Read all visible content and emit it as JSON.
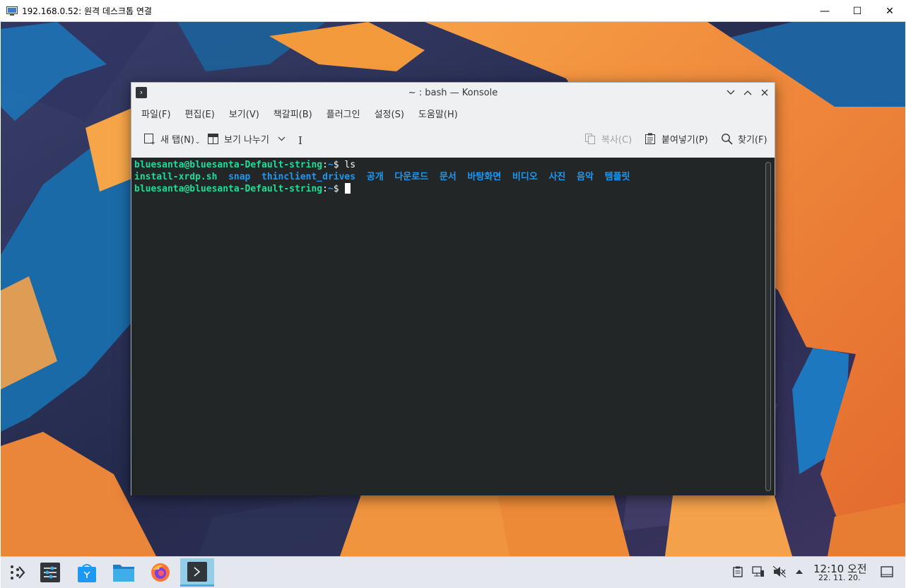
{
  "rdp": {
    "title": "192.168.0.52: 원격 데스크톱 연결",
    "minimize_glyph": "—",
    "maximize_glyph": "☐",
    "close_glyph": "✕"
  },
  "konsole": {
    "title": "~ : bash — Konsole",
    "menu": [
      "파일(F)",
      "편집(E)",
      "보기(V)",
      "책갈피(B)",
      "플러그인",
      "설정(S)",
      "도움말(H)"
    ],
    "toolbar": {
      "new_tab": "새 탭(N)",
      "split_view": "보기 나누기",
      "copy": "복사(C)",
      "paste": "붙여넣기(P)",
      "find": "찾기(F)"
    },
    "terminal": {
      "prompt_user": "bluesanta@bluesanta-Default-string",
      "prompt_path": "~",
      "prompt_symbol": "$",
      "command": " ls",
      "ls_files": [
        "install-xrdp.sh"
      ],
      "ls_dirs": [
        "snap",
        "thinclient_drives",
        "공개",
        "다운로드",
        "문서",
        "바탕화면",
        "비디오",
        "사진",
        "음악",
        "템플릿"
      ]
    }
  },
  "taskbar": {
    "apps": [
      "app-launcher-icon",
      "system-settings-icon",
      "discover-icon",
      "dolphin-icon",
      "firefox-icon",
      "konsole-icon"
    ],
    "clock_time": "12:10 오전",
    "clock_date": "22. 11. 20."
  },
  "colors": {
    "terminal_bg": "#232627",
    "prompt_green": "#1cdc9a",
    "dir_blue": "#1d99f3",
    "active_task": "#93cee9"
  }
}
